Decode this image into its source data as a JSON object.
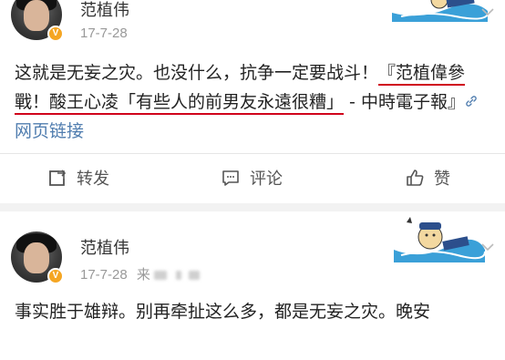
{
  "posts": [
    {
      "author": "范植伟",
      "date": "17-7-28",
      "text_parts": {
        "p1": "这就是无妄之灾。也没什么，抗争一定要战斗！",
        "p2": "『范植偉參戰！酸王心凌「有些人的前男友永遠很糟」",
        "p3": " - 中時電子報』",
        "link": "网页链接"
      },
      "actions": {
        "repost": "转发",
        "comment": "评论",
        "like": "赞"
      }
    },
    {
      "author": "范植伟",
      "date": "17-7-28",
      "source_prefix": "来",
      "text": "事实胜于雄辩。别再牵扯这么多，都是无妄之灾。晚安"
    }
  ],
  "icons": {
    "verified": "verified-v-icon",
    "link": "link-icon",
    "repost": "repost-icon",
    "comment": "comment-icon",
    "like": "thumbs-up-icon",
    "expand": "chevron-down-icon"
  },
  "colors": {
    "link": "#507daf",
    "underline": "#d0021b",
    "verified": "#f5a623",
    "meta": "#999999"
  }
}
